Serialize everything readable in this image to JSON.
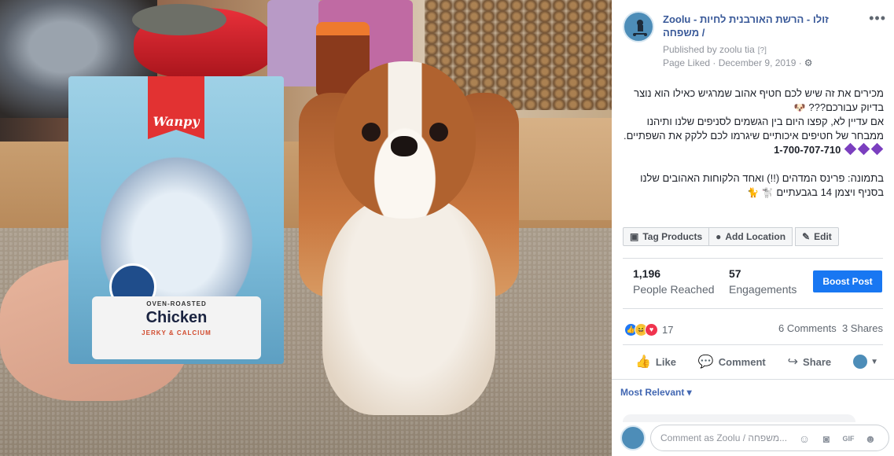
{
  "photo": {
    "packet": {
      "brand": "Wanpy",
      "preparation": "OVEN-ROASTED",
      "flavor": "Chicken",
      "subtitle": "JERKY & CALCIUM"
    }
  },
  "post": {
    "page_name": "Zoolu - זולו - הרשת האורבנית לחיות משפחה /",
    "published_by": "Published by zoolu tia",
    "published_help": "[?]",
    "liked_date": "Page Liked · December 9, 2019 ·",
    "more_label": "•••",
    "body": {
      "line1": "מכירים את זה שיש לכם חטיף אהוב שמרגיש כאילו הוא נוצר בדיוק עבורכם???",
      "line1_emoji": "🐶",
      "line2": "אם עדיין לא, קפצו היום בין הגשמים לסניפים שלנו ותיהנו ממבחר של חטיפים איכותיים שיגרמו לכם ללקק את השפתיים.",
      "phone": "1-700-707-710",
      "line3": "בתמונה: פרינס המדהים (!!) ואחד הלקוחות האהובים שלנו בסניף ויצמן 14 בגבעתיים",
      "line3_emoji": "🐩 🐈"
    },
    "tools": {
      "tag_products": "Tag Products",
      "add_location": "Add Location",
      "edit": "Edit"
    },
    "stats": {
      "reached_value": "1,196",
      "reached_label": "People Reached",
      "engagements_value": "57",
      "engagements_label": "Engagements",
      "boost_label": "Boost Post"
    },
    "reactions": {
      "count": "17",
      "comments": "6 Comments",
      "shares": "3 Shares"
    },
    "actions": {
      "like": "Like",
      "comment": "Comment",
      "share": "Share"
    },
    "most_relevant": "Most Relevant ▾",
    "comment_placeholder": "Comment as Zoolu / משפחה..."
  },
  "colors": {
    "link": "#385898",
    "boost": "#1877f2",
    "like_reaction": "#2078f4",
    "love_reaction": "#f0344e",
    "haha_reaction": "#f7c13b"
  }
}
